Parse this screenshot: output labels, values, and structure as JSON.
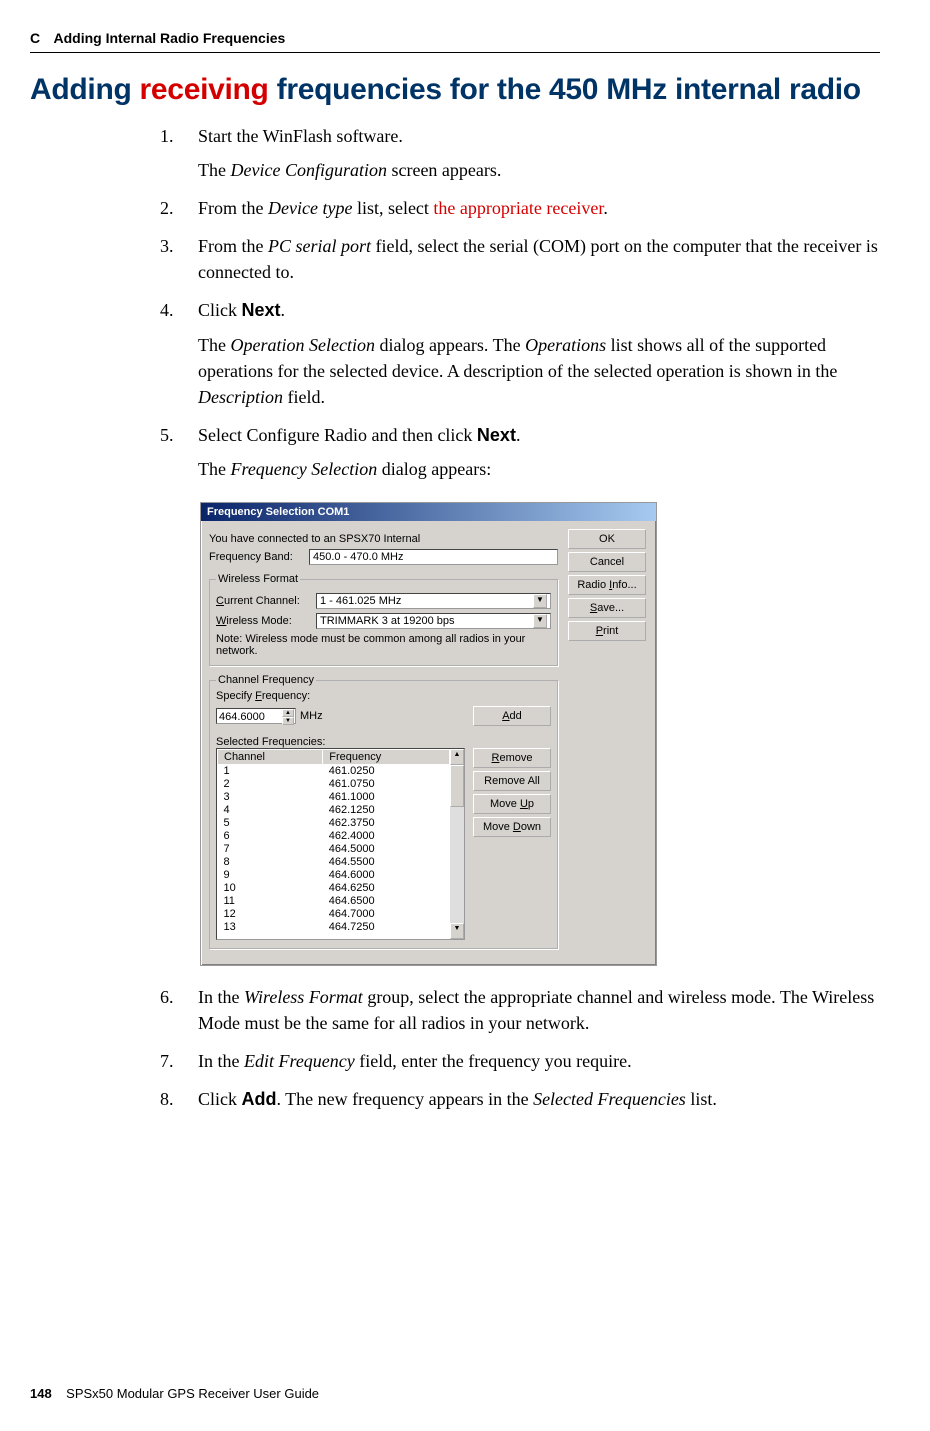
{
  "header": {
    "section_letter": "C",
    "section_title": "Adding Internal Radio Frequencies"
  },
  "title": {
    "p1": "Adding ",
    "red": "receiving",
    "p2": " frequencies for the 450 MHz internal radio"
  },
  "steps": {
    "s1": {
      "main": "Start the WinFlash software.",
      "sub1_a": "The ",
      "sub1_b": "Device Configuration",
      "sub1_c": " screen appears."
    },
    "s2": {
      "a": "From the ",
      "b": "Device type",
      "c": " list, select ",
      "d": "the appropriate receiver",
      "e": "."
    },
    "s3": {
      "a": "From the ",
      "b": "PC serial port",
      "c": " field, select the serial (COM) port on the computer that the receiver is connected to."
    },
    "s4": {
      "a": "Click ",
      "b": "Next",
      "c": ".",
      "sub_a": "The ",
      "sub_b": "Operation Selection",
      "sub_c": " dialog appears. The ",
      "sub_d": "Operations",
      "sub_e": " list shows all of the supported operations for the selected device. A description of the selected operation is shown in the ",
      "sub_f": "Description",
      "sub_g": " field."
    },
    "s5": {
      "a": "Select Configure Radio and then click ",
      "b": "Next",
      "c": ".",
      "sub_a": "The ",
      "sub_b": "Frequency Selection",
      "sub_c": " dialog appears:"
    },
    "s6": {
      "a": "In the ",
      "b": "Wireless Format",
      "c": " group, select the appropriate channel and wireless mode. The Wireless Mode must be the same for all radios in your network."
    },
    "s7": {
      "a": "In the ",
      "b": "Edit Frequency",
      "c": " field, enter the frequency you require."
    },
    "s8": {
      "a": "Click ",
      "b": "Add",
      "c": ". The new frequency appears in the ",
      "d": "Selected Frequencies",
      "e": " list."
    }
  },
  "dialog": {
    "title": "Frequency Selection COM1",
    "connected": "You have connected to an SPSX70 Internal",
    "freq_band_label": "Frequency Band:",
    "freq_band_value": "450.0 - 470.0 MHz",
    "group_wf": "Wireless Format",
    "curr_ch_label_a": "C",
    "curr_ch_label_b": "urrent Channel:",
    "curr_ch_value": "1 - 461.025 MHz",
    "wmode_label_a": "W",
    "wmode_label_b": "ireless Mode:",
    "wmode_value": "TRIMMARK 3 at 19200 bps",
    "note": "Note: Wireless mode must be common among all radios in your network.",
    "group_cf": "Channel Frequency",
    "specify_label_a": "Specify ",
    "specify_label_b": "F",
    "specify_label_c": "requency:",
    "specify_value": "464.6000",
    "mhz": "MHz",
    "add": "Add",
    "add_u": "A",
    "add_rest": "dd",
    "sel_label": "Selected Frequencies:",
    "th_channel": "Channel",
    "th_freq": "Frequency",
    "rows": [
      {
        "c": "1",
        "f": "461.0250"
      },
      {
        "c": "2",
        "f": "461.0750"
      },
      {
        "c": "3",
        "f": "461.1000"
      },
      {
        "c": "4",
        "f": "462.1250"
      },
      {
        "c": "5",
        "f": "462.3750"
      },
      {
        "c": "6",
        "f": "462.4000"
      },
      {
        "c": "7",
        "f": "464.5000"
      },
      {
        "c": "8",
        "f": "464.5500"
      },
      {
        "c": "9",
        "f": "464.6000"
      },
      {
        "c": "10",
        "f": "464.6250"
      },
      {
        "c": "11",
        "f": "464.6500"
      },
      {
        "c": "12",
        "f": "464.7000"
      },
      {
        "c": "13",
        "f": "464.7250"
      }
    ],
    "btn_remove_a": "R",
    "btn_remove_b": "emove",
    "btn_remove_all": "Remove All",
    "btn_moveup_a": "Move ",
    "btn_moveup_b": "U",
    "btn_moveup_c": "p",
    "btn_movedn_a": "Move ",
    "btn_movedn_b": "D",
    "btn_movedn_c": "own",
    "btn_ok": "OK",
    "btn_cancel": "Cancel",
    "btn_radioinfo_a": "Radio ",
    "btn_radioinfo_b": "I",
    "btn_radioinfo_c": "nfo...",
    "btn_save_a": "S",
    "btn_save_b": "ave...",
    "btn_print_a": "P",
    "btn_print_b": "rint"
  },
  "footer": {
    "page": "148",
    "guide": "SPSx50 Modular GPS Receiver User Guide"
  }
}
